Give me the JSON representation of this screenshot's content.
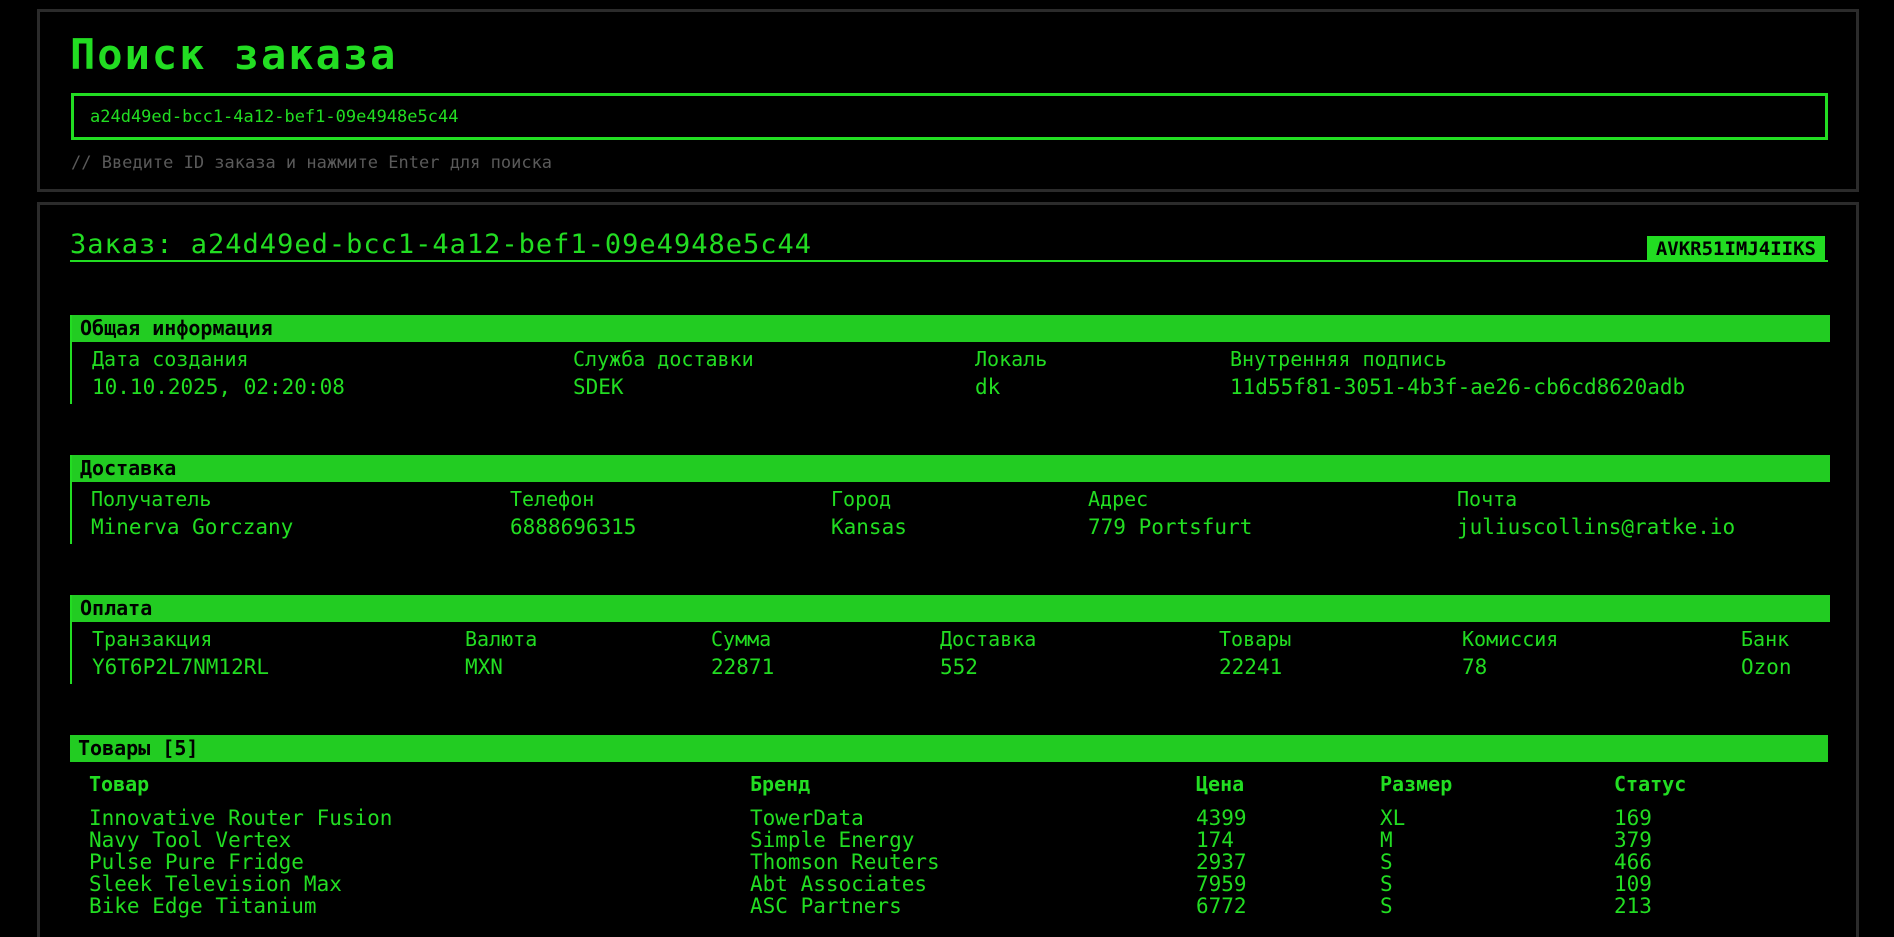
{
  "search": {
    "title": "Поиск заказа",
    "value": "a24d49ed-bcc1-4a12-bef1-09e4948e5c44",
    "hint": "// Введите ID заказа и нажмите Enter для поиска"
  },
  "order": {
    "title": "Заказ: a24d49ed-bcc1-4a12-bef1-09e4948e5c44",
    "code": "AVKR51IMJ4IIKS"
  },
  "general": {
    "header": "Общая информация",
    "created_label": "Дата создания",
    "created_value": "10.10.2025, 02:20:08",
    "service_label": "Служба доставки",
    "service_value": "SDEK",
    "locale_label": "Локаль",
    "locale_value": "dk",
    "signature_label": "Внутренняя подпись",
    "signature_value": "11d55f81-3051-4b3f-ae26-cb6cd8620adb"
  },
  "delivery": {
    "header": "Доставка",
    "recipient_label": "Получатель",
    "recipient_value": "Minerva Gorczany",
    "phone_label": "Телефон",
    "phone_value": "6888696315",
    "city_label": "Город",
    "city_value": "Kansas",
    "address_label": "Адрес",
    "address_value": "779 Portsfurt",
    "email_label": "Почта",
    "email_value": "juliuscollins@ratke.io"
  },
  "payment": {
    "header": "Оплата",
    "transaction_label": "Транзакция",
    "transaction_value": "Y6T6P2L7NM12RL",
    "currency_label": "Валюта",
    "currency_value": "MXN",
    "amount_label": "Сумма",
    "amount_value": "22871",
    "delivery_label": "Доставка",
    "delivery_value": "552",
    "goods_label": "Товары",
    "goods_value": "22241",
    "fee_label": "Комиссия",
    "fee_value": "78",
    "bank_label": "Банк",
    "bank_value": "Ozon"
  },
  "items": {
    "header": "Товары [5]",
    "columns": [
      "Товар",
      "Бренд",
      "Цена",
      "Размер",
      "Статус"
    ],
    "rows": [
      [
        "Innovative Router Fusion",
        "TowerData",
        "4399",
        "XL",
        "169"
      ],
      [
        "Navy Tool Vertex",
        "Simple Energy",
        "174",
        "M",
        "379"
      ],
      [
        "Pulse Pure Fridge",
        "Thomson Reuters",
        "2937",
        "S",
        "466"
      ],
      [
        "Sleek Television Max",
        "Abt Associates",
        "7959",
        "S",
        "109"
      ],
      [
        "Bike Edge Titanium",
        "ASC Partners",
        "6772",
        "S",
        "213"
      ]
    ]
  }
}
